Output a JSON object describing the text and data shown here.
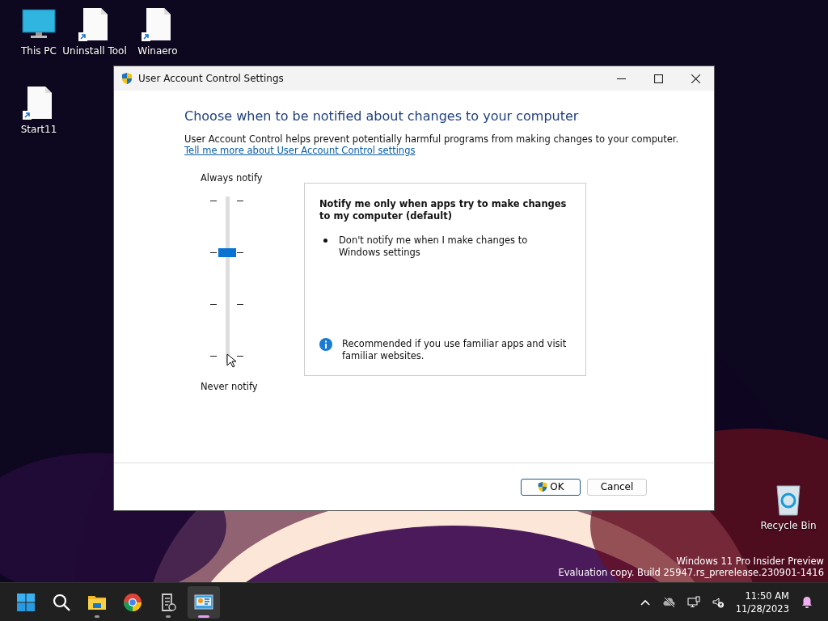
{
  "desktop_icons": [
    {
      "kind": "monitor",
      "label": "This PC",
      "shortcut": false
    },
    {
      "kind": "file",
      "label": "Uninstall Tool",
      "shortcut": true
    },
    {
      "kind": "file",
      "label": "Winaero",
      "shortcut": true
    },
    {
      "kind": "file",
      "label": "Start11",
      "shortcut": true
    },
    {
      "kind": "bin",
      "label": "Recycle Bin",
      "shortcut": false
    }
  ],
  "window": {
    "title": "User Account Control Settings",
    "heading": "Choose when to be notified about changes to your computer",
    "intro": "User Account Control helps prevent potentially harmful programs from making changes to your computer.",
    "link": "Tell me more about User Account Control settings",
    "slider": {
      "top_label": "Always notify",
      "bottom_label": "Never notify",
      "level": 0.667
    },
    "description": {
      "title": "Notify me only when apps try to make changes to my computer (default)",
      "bullets": [
        "Don't notify me when I make changes to Windows settings"
      ],
      "note": "Recommended if you use familiar apps and visit familiar websites."
    },
    "buttons": [
      {
        "label": "OK",
        "shield": true,
        "default": true
      },
      {
        "label": "Cancel",
        "shield": false,
        "default": false
      }
    ]
  },
  "watermark": [
    "Windows 11 Pro Insider Preview",
    "Evaluation copy. Build 25947.rs_prerelease.230901-1416"
  ],
  "taskbar": {
    "items": [
      {
        "kind": "start",
        "running": false,
        "selected": false
      },
      {
        "kind": "search",
        "running": false,
        "selected": false
      },
      {
        "kind": "folder",
        "running": true,
        "selected": false
      },
      {
        "kind": "browser",
        "running": false,
        "selected": false
      },
      {
        "kind": "notepad",
        "running": true,
        "selected": false
      },
      {
        "kind": "control-panel",
        "running": true,
        "selected": true
      }
    ],
    "time": "11:50 AM",
    "date": "11/28/2023"
  }
}
